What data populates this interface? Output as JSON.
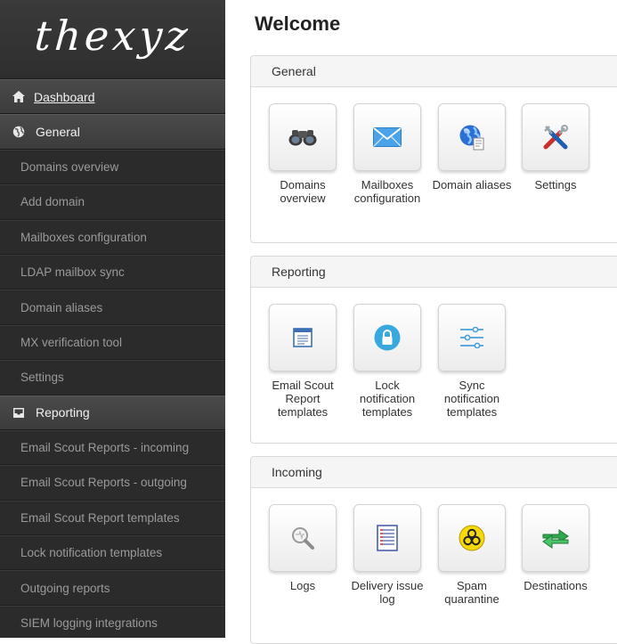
{
  "logo": {
    "text": "thexyz"
  },
  "page": {
    "title": "Welcome"
  },
  "sidebar": {
    "items": [
      {
        "label": "Dashboard",
        "kind": "header",
        "icon": "home-icon"
      },
      {
        "label": "General",
        "kind": "header",
        "icon": "globe-icon"
      },
      {
        "label": "Domains overview",
        "kind": "item"
      },
      {
        "label": "Add domain",
        "kind": "item"
      },
      {
        "label": "Mailboxes configuration",
        "kind": "item"
      },
      {
        "label": "LDAP mailbox sync",
        "kind": "item"
      },
      {
        "label": "Domain aliases",
        "kind": "item"
      },
      {
        "label": "MX verification tool",
        "kind": "item"
      },
      {
        "label": "Settings",
        "kind": "item"
      },
      {
        "label": "Reporting",
        "kind": "header",
        "icon": "inbox-icon"
      },
      {
        "label": "Email Scout Reports - incoming",
        "kind": "item"
      },
      {
        "label": "Email Scout Reports - outgoing",
        "kind": "item"
      },
      {
        "label": "Email Scout Report templates",
        "kind": "item"
      },
      {
        "label": "Lock notification templates",
        "kind": "item"
      },
      {
        "label": "Outgoing reports",
        "kind": "item"
      },
      {
        "label": "SIEM logging integrations",
        "kind": "item"
      }
    ]
  },
  "panels": [
    {
      "title": "General",
      "tiles": [
        {
          "label": "Domains\noverview",
          "icon": "binoculars-icon"
        },
        {
          "label": "Mailboxes\nconfiguration",
          "icon": "envelope-icon"
        },
        {
          "label": "Domain aliases",
          "icon": "globe-document-icon"
        },
        {
          "label": "Settings",
          "icon": "tools-icon"
        }
      ]
    },
    {
      "title": "Reporting",
      "tiles": [
        {
          "label": "Email Scout\nReport\ntemplates",
          "icon": "report-template-icon"
        },
        {
          "label": "Lock\nnotification\ntemplates",
          "icon": "lock-icon"
        },
        {
          "label": "Sync\nnotification\ntemplates",
          "icon": "sliders-icon"
        }
      ]
    },
    {
      "title": "Incoming",
      "tiles": [
        {
          "label": "Logs",
          "icon": "magnifier-icon"
        },
        {
          "label": "Delivery issue\nlog",
          "icon": "document-list-icon"
        },
        {
          "label": "Spam\nquarantine",
          "icon": "biohazard-icon"
        },
        {
          "label": "Destinations",
          "icon": "arrows-icon"
        }
      ]
    }
  ]
}
